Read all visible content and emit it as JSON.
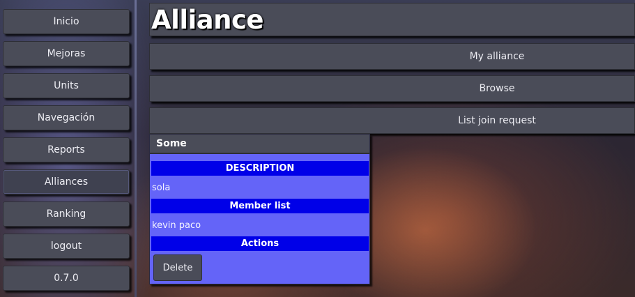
{
  "sidebar": {
    "items": [
      {
        "label": "Inicio"
      },
      {
        "label": "Mejoras"
      },
      {
        "label": "Units"
      },
      {
        "label": "Navegación"
      },
      {
        "label": "Reports"
      },
      {
        "label": "Alliances",
        "active": true
      },
      {
        "label": "Ranking"
      },
      {
        "label": "logout"
      },
      {
        "label": "0.7.0"
      }
    ]
  },
  "header": {
    "title": "Alliance"
  },
  "tabs": [
    {
      "label": "My alliance"
    },
    {
      "label": "Browse"
    },
    {
      "label": "List join request"
    }
  ],
  "alliance": {
    "name": "Some",
    "description_header": "DESCRIPTION",
    "description": "sola",
    "members_header": "Member list",
    "members": "kevin paco",
    "actions_header": "Actions",
    "delete_label": "Delete"
  },
  "colors": {
    "button_bg": "#4a4c58",
    "panel_bg": "#6464f8",
    "section_header_bg": "#0000e8"
  }
}
